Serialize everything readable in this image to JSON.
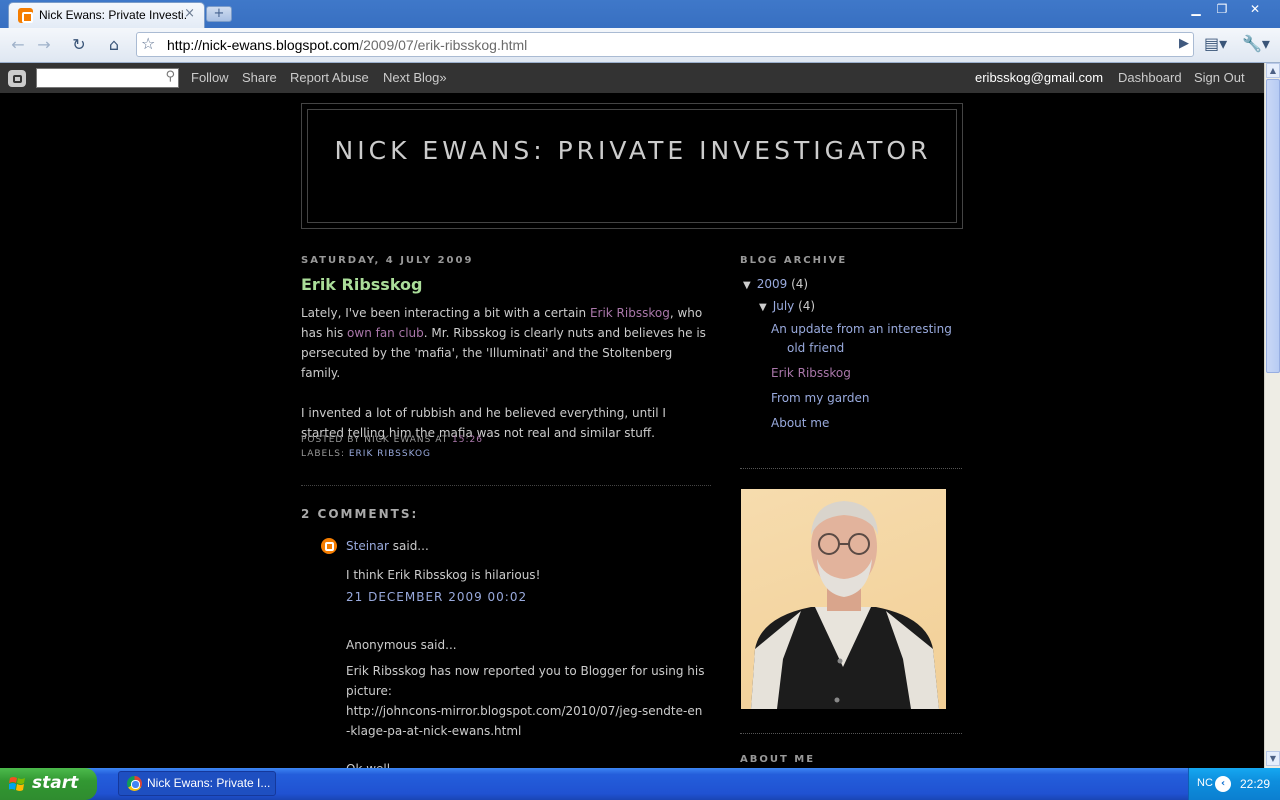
{
  "browser": {
    "tab_title": "Nick Ewans: Private Investi...",
    "tab_close": "×",
    "new_tab": "+",
    "url_host": "http://nick-ewans.blogspot.com",
    "url_path": "/2009/07/erik-ribsskog.html"
  },
  "navbar": {
    "follow": "Follow",
    "share": "Share",
    "report_abuse": "Report Abuse",
    "next_blog": "Next Blog»",
    "email": "eribsskog@gmail.com",
    "dashboard": "Dashboard",
    "sign_out": "Sign Out"
  },
  "header": {
    "title": "NICK EWANS: PRIVATE INVESTIGATOR"
  },
  "post": {
    "date": "SATURDAY, 4 JULY 2009",
    "title": "Erik Ribsskog",
    "p1_a": "Lately, I've been interacting a bit with a certain ",
    "p1_link1": "Erik Ribsskog",
    "p1_b": ", who has his ",
    "p1_link2": "own fan club",
    "p1_c": ". Mr. Ribsskog is clearly nuts and believes he is persecuted by the 'mafia', the 'Illuminati' and the Stoltenberg family.",
    "p2": "I invented a lot of rubbish and he believed everything, until I started telling him the mafia was not real and similar stuff.",
    "posted_by": "POSTED BY NICK EWANS AT ",
    "time": "15:26",
    "labels_prefix": "LABELS: ",
    "label": "ERIK RIBSSKOG"
  },
  "comments": {
    "heading": "2 COMMENTS:",
    "c1_author": "Steinar",
    "c1_said": " said...",
    "c1_text": "I think Erik Ribsskog is hilarious!",
    "c1_time": "21 DECEMBER 2009 00:02",
    "c2_author": "Anonymous said...",
    "c2_text": "Erik Ribsskog has now reported you to Blogger for using his picture:",
    "c2_link": "http://johncons-mirror.blogspot.com/2010/07/jeg-sendte-en-klage-pa-at-nick-ewans.html",
    "c3_author": "Ok well..."
  },
  "sidebar": {
    "archive_heading": "BLOG ARCHIVE",
    "year": "2009",
    "year_count": " (4)",
    "month": "July",
    "month_count": " (4)",
    "posts": [
      "An update from an interesting old friend",
      "Erik Ribsskog",
      "From my garden",
      "About me"
    ],
    "about_heading": "ABOUT ME"
  },
  "taskbar": {
    "start": "start",
    "task_label": "Nick Ewans: Private I...",
    "lang": "NC",
    "clock": "22:29"
  }
}
